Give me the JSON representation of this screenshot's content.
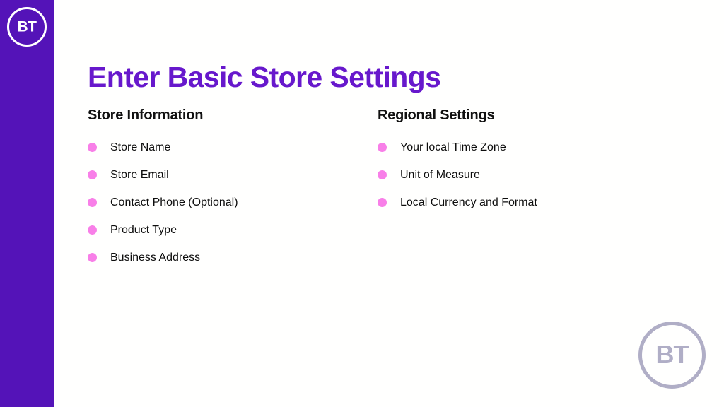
{
  "slide": {
    "title": "Enter Basic Store Settings",
    "background_color": "#fffffe",
    "title_color": "#6718cc"
  },
  "sidebar": {
    "background_color": "#5413b8",
    "logo": {
      "icon_name": "bt-circle-logo-icon",
      "text": "BT",
      "color": "#ffffff"
    }
  },
  "columns": [
    {
      "heading": "Store Information",
      "bullet_color": "#f87fe8",
      "items": [
        {
          "label": "Store Name"
        },
        {
          "label": "Store Email"
        },
        {
          "label": "Contact Phone (Optional)"
        },
        {
          "label": "Product Type"
        },
        {
          "label": "Business Address"
        }
      ]
    },
    {
      "heading": "Regional Settings",
      "bullet_color": "#f87fe8",
      "items": [
        {
          "label": "Your local Time Zone"
        },
        {
          "label": "Unit of Measure"
        },
        {
          "label": "Local Currency and Format"
        }
      ]
    }
  ],
  "watermark": {
    "icon_name": "bt-circle-watermark-icon",
    "text": "BT",
    "color": "#b0aec6"
  }
}
